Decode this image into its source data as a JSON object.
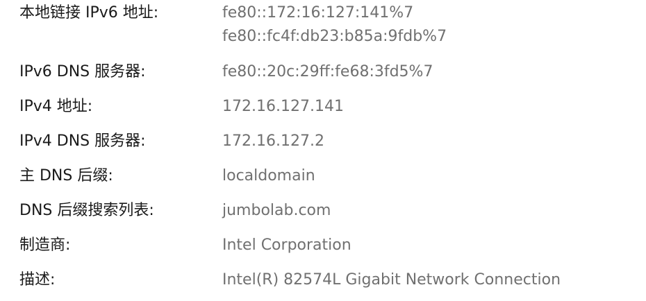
{
  "properties": [
    {
      "label": "本地链接 IPv6 地址:",
      "values": [
        "fe80::172:16:127:141%7",
        "fe80::fc4f:db23:b85a:9fdb%7"
      ]
    },
    {
      "label": "IPv6 DNS 服务器:",
      "values": [
        "fe80::20c:29ff:fe68:3fd5%7"
      ]
    },
    {
      "label": "IPv4 地址:",
      "values": [
        "172.16.127.141"
      ]
    },
    {
      "label": "IPv4 DNS 服务器:",
      "values": [
        "172.16.127.2"
      ]
    },
    {
      "label": "主 DNS 后缀:",
      "values": [
        "localdomain"
      ]
    },
    {
      "label": "DNS 后缀搜索列表:",
      "values": [
        "jumbolab.com"
      ]
    },
    {
      "label": "制造商:",
      "values": [
        "Intel Corporation"
      ]
    },
    {
      "label": "描述:",
      "values": [
        "Intel(R) 82574L Gigabit Network Connection"
      ]
    }
  ]
}
